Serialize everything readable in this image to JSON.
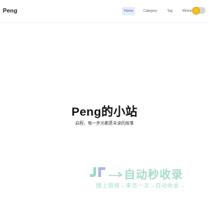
{
  "header": {
    "brand": "Peng",
    "nav": [
      {
        "label": "Home",
        "active": true
      },
      {
        "label": "Category",
        "active": false
      },
      {
        "label": "Tag",
        "active": false
      },
      {
        "label": "Moment",
        "active": false
      }
    ],
    "theme_toggle_icon": "sun-icon"
  },
  "hero": {
    "title": "Peng的小站",
    "subtitle": "启程，每一步光都是未读的故事"
  },
  "watermark": {
    "title": "自动秒收录",
    "subtitle": "酸上链接→来访一次→自动收录→",
    "color": "#a8dcc8"
  },
  "colors": {
    "nav_active_bg": "#e7ecf8",
    "nav_active_text": "#4a66c7",
    "toggle_knob": "#f4c21b"
  }
}
